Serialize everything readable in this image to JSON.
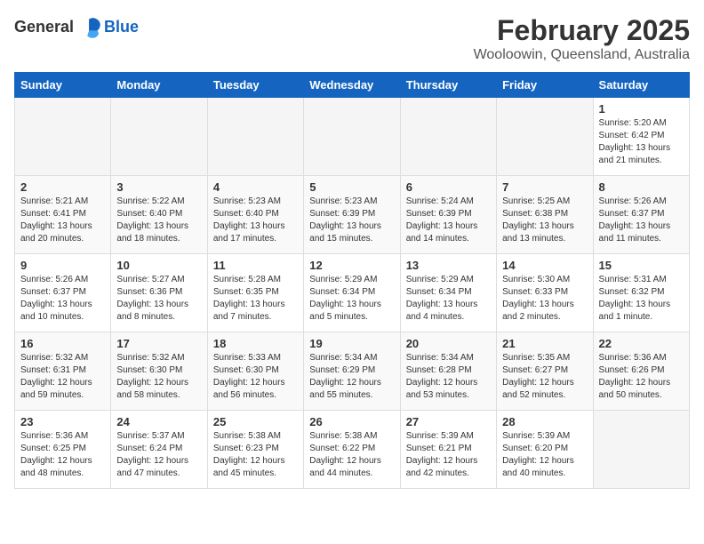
{
  "app": {
    "name_general": "General",
    "name_blue": "Blue"
  },
  "header": {
    "month_year": "February 2025",
    "location": "Wooloowin, Queensland, Australia"
  },
  "weekdays": [
    "Sunday",
    "Monday",
    "Tuesday",
    "Wednesday",
    "Thursday",
    "Friday",
    "Saturday"
  ],
  "weeks": [
    [
      {
        "day": "",
        "info": ""
      },
      {
        "day": "",
        "info": ""
      },
      {
        "day": "",
        "info": ""
      },
      {
        "day": "",
        "info": ""
      },
      {
        "day": "",
        "info": ""
      },
      {
        "day": "",
        "info": ""
      },
      {
        "day": "1",
        "info": "Sunrise: 5:20 AM\nSunset: 6:42 PM\nDaylight: 13 hours\nand 21 minutes."
      }
    ],
    [
      {
        "day": "2",
        "info": "Sunrise: 5:21 AM\nSunset: 6:41 PM\nDaylight: 13 hours\nand 20 minutes."
      },
      {
        "day": "3",
        "info": "Sunrise: 5:22 AM\nSunset: 6:40 PM\nDaylight: 13 hours\nand 18 minutes."
      },
      {
        "day": "4",
        "info": "Sunrise: 5:23 AM\nSunset: 6:40 PM\nDaylight: 13 hours\nand 17 minutes."
      },
      {
        "day": "5",
        "info": "Sunrise: 5:23 AM\nSunset: 6:39 PM\nDaylight: 13 hours\nand 15 minutes."
      },
      {
        "day": "6",
        "info": "Sunrise: 5:24 AM\nSunset: 6:39 PM\nDaylight: 13 hours\nand 14 minutes."
      },
      {
        "day": "7",
        "info": "Sunrise: 5:25 AM\nSunset: 6:38 PM\nDaylight: 13 hours\nand 13 minutes."
      },
      {
        "day": "8",
        "info": "Sunrise: 5:26 AM\nSunset: 6:37 PM\nDaylight: 13 hours\nand 11 minutes."
      }
    ],
    [
      {
        "day": "9",
        "info": "Sunrise: 5:26 AM\nSunset: 6:37 PM\nDaylight: 13 hours\nand 10 minutes."
      },
      {
        "day": "10",
        "info": "Sunrise: 5:27 AM\nSunset: 6:36 PM\nDaylight: 13 hours\nand 8 minutes."
      },
      {
        "day": "11",
        "info": "Sunrise: 5:28 AM\nSunset: 6:35 PM\nDaylight: 13 hours\nand 7 minutes."
      },
      {
        "day": "12",
        "info": "Sunrise: 5:29 AM\nSunset: 6:34 PM\nDaylight: 13 hours\nand 5 minutes."
      },
      {
        "day": "13",
        "info": "Sunrise: 5:29 AM\nSunset: 6:34 PM\nDaylight: 13 hours\nand 4 minutes."
      },
      {
        "day": "14",
        "info": "Sunrise: 5:30 AM\nSunset: 6:33 PM\nDaylight: 13 hours\nand 2 minutes."
      },
      {
        "day": "15",
        "info": "Sunrise: 5:31 AM\nSunset: 6:32 PM\nDaylight: 13 hours\nand 1 minute."
      }
    ],
    [
      {
        "day": "16",
        "info": "Sunrise: 5:32 AM\nSunset: 6:31 PM\nDaylight: 12 hours\nand 59 minutes."
      },
      {
        "day": "17",
        "info": "Sunrise: 5:32 AM\nSunset: 6:30 PM\nDaylight: 12 hours\nand 58 minutes."
      },
      {
        "day": "18",
        "info": "Sunrise: 5:33 AM\nSunset: 6:30 PM\nDaylight: 12 hours\nand 56 minutes."
      },
      {
        "day": "19",
        "info": "Sunrise: 5:34 AM\nSunset: 6:29 PM\nDaylight: 12 hours\nand 55 minutes."
      },
      {
        "day": "20",
        "info": "Sunrise: 5:34 AM\nSunset: 6:28 PM\nDaylight: 12 hours\nand 53 minutes."
      },
      {
        "day": "21",
        "info": "Sunrise: 5:35 AM\nSunset: 6:27 PM\nDaylight: 12 hours\nand 52 minutes."
      },
      {
        "day": "22",
        "info": "Sunrise: 5:36 AM\nSunset: 6:26 PM\nDaylight: 12 hours\nand 50 minutes."
      }
    ],
    [
      {
        "day": "23",
        "info": "Sunrise: 5:36 AM\nSunset: 6:25 PM\nDaylight: 12 hours\nand 48 minutes."
      },
      {
        "day": "24",
        "info": "Sunrise: 5:37 AM\nSunset: 6:24 PM\nDaylight: 12 hours\nand 47 minutes."
      },
      {
        "day": "25",
        "info": "Sunrise: 5:38 AM\nSunset: 6:23 PM\nDaylight: 12 hours\nand 45 minutes."
      },
      {
        "day": "26",
        "info": "Sunrise: 5:38 AM\nSunset: 6:22 PM\nDaylight: 12 hours\nand 44 minutes."
      },
      {
        "day": "27",
        "info": "Sunrise: 5:39 AM\nSunset: 6:21 PM\nDaylight: 12 hours\nand 42 minutes."
      },
      {
        "day": "28",
        "info": "Sunrise: 5:39 AM\nSunset: 6:20 PM\nDaylight: 12 hours\nand 40 minutes."
      },
      {
        "day": "",
        "info": ""
      }
    ]
  ]
}
